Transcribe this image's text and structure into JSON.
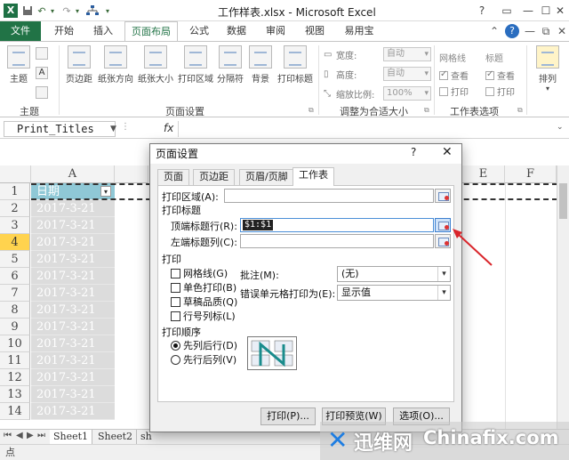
{
  "window": {
    "title": "工作样表.xlsx - Microsoft Excel",
    "help": "?",
    "ribbon_help": "?"
  },
  "ribbon_tabs": [
    "文件",
    "开始",
    "插入",
    "页面布局",
    "公式",
    "数据",
    "审阅",
    "视图",
    "易用宝"
  ],
  "ribbon": {
    "groups": {
      "theme": {
        "label": "主题",
        "buttons": [
          "主题"
        ]
      },
      "page_setup": {
        "label": "页面设置",
        "buttons": [
          "页边距",
          "纸张方向",
          "纸张大小",
          "打印区域",
          "分隔符",
          "背景",
          "打印标题"
        ]
      },
      "scale": {
        "label": "调整为合适大小",
        "rows": [
          {
            "label": "宽度:",
            "value": "自动"
          },
          {
            "label": "高度:",
            "value": "自动"
          },
          {
            "label": "缩放比例:",
            "value": "100%"
          }
        ]
      },
      "sheet_options": {
        "label": "工作表选项",
        "gridlines": {
          "title": "网格线",
          "view": "查看",
          "print": "打印"
        },
        "headings": {
          "title": "标题",
          "view": "查看",
          "print": "打印"
        }
      },
      "arrange": {
        "label": "排列"
      }
    }
  },
  "formula_bar": {
    "name_box": "Print_Titles",
    "fx": "fx"
  },
  "grid": {
    "columns": [
      "A",
      "E",
      "F"
    ],
    "rows": [
      "1",
      "2",
      "3",
      "4",
      "5",
      "6",
      "7",
      "8",
      "9",
      "10",
      "11",
      "12",
      "13",
      "14"
    ],
    "header_cell": "日期",
    "date_value": "2017-3-21",
    "selected_row": "4"
  },
  "sheet_tabs": [
    "Sheet1",
    "Sheet2",
    "sh"
  ],
  "status_bar": {
    "text": "点"
  },
  "dialog": {
    "title": "页面设置",
    "tabs": [
      "页面",
      "页边距",
      "页眉/页脚",
      "工作表"
    ],
    "print_area_label": "打印区域(A):",
    "print_titles_label": "打印标题",
    "rows_repeat_label": "顶端标题行(R):",
    "rows_repeat_value": "$1:$1",
    "cols_repeat_label": "左端标题列(C):",
    "print_section_label": "打印",
    "checkboxes": [
      "网格线(G)",
      "单色打印(B)",
      "草稿品质(Q)",
      "行号列标(L)"
    ],
    "comments_label": "批注(M):",
    "comments_value": "(无)",
    "errors_label": "错误单元格打印为(E):",
    "errors_value": "显示值",
    "order_label": "打印顺序",
    "order_options": [
      "先列后行(D)",
      "先行后列(V)"
    ],
    "buttons": {
      "print": "打印(P)...",
      "preview": "打印预览(W)",
      "options": "选项(O)..."
    }
  },
  "watermark": {
    "cn": "迅维网",
    "en": "Chinafix.com"
  },
  "colors": {
    "excel_green": "#217346",
    "header_cell": "#8fc8d6",
    "selected_row": "#ffd34e",
    "arrow": "#d9252b"
  }
}
